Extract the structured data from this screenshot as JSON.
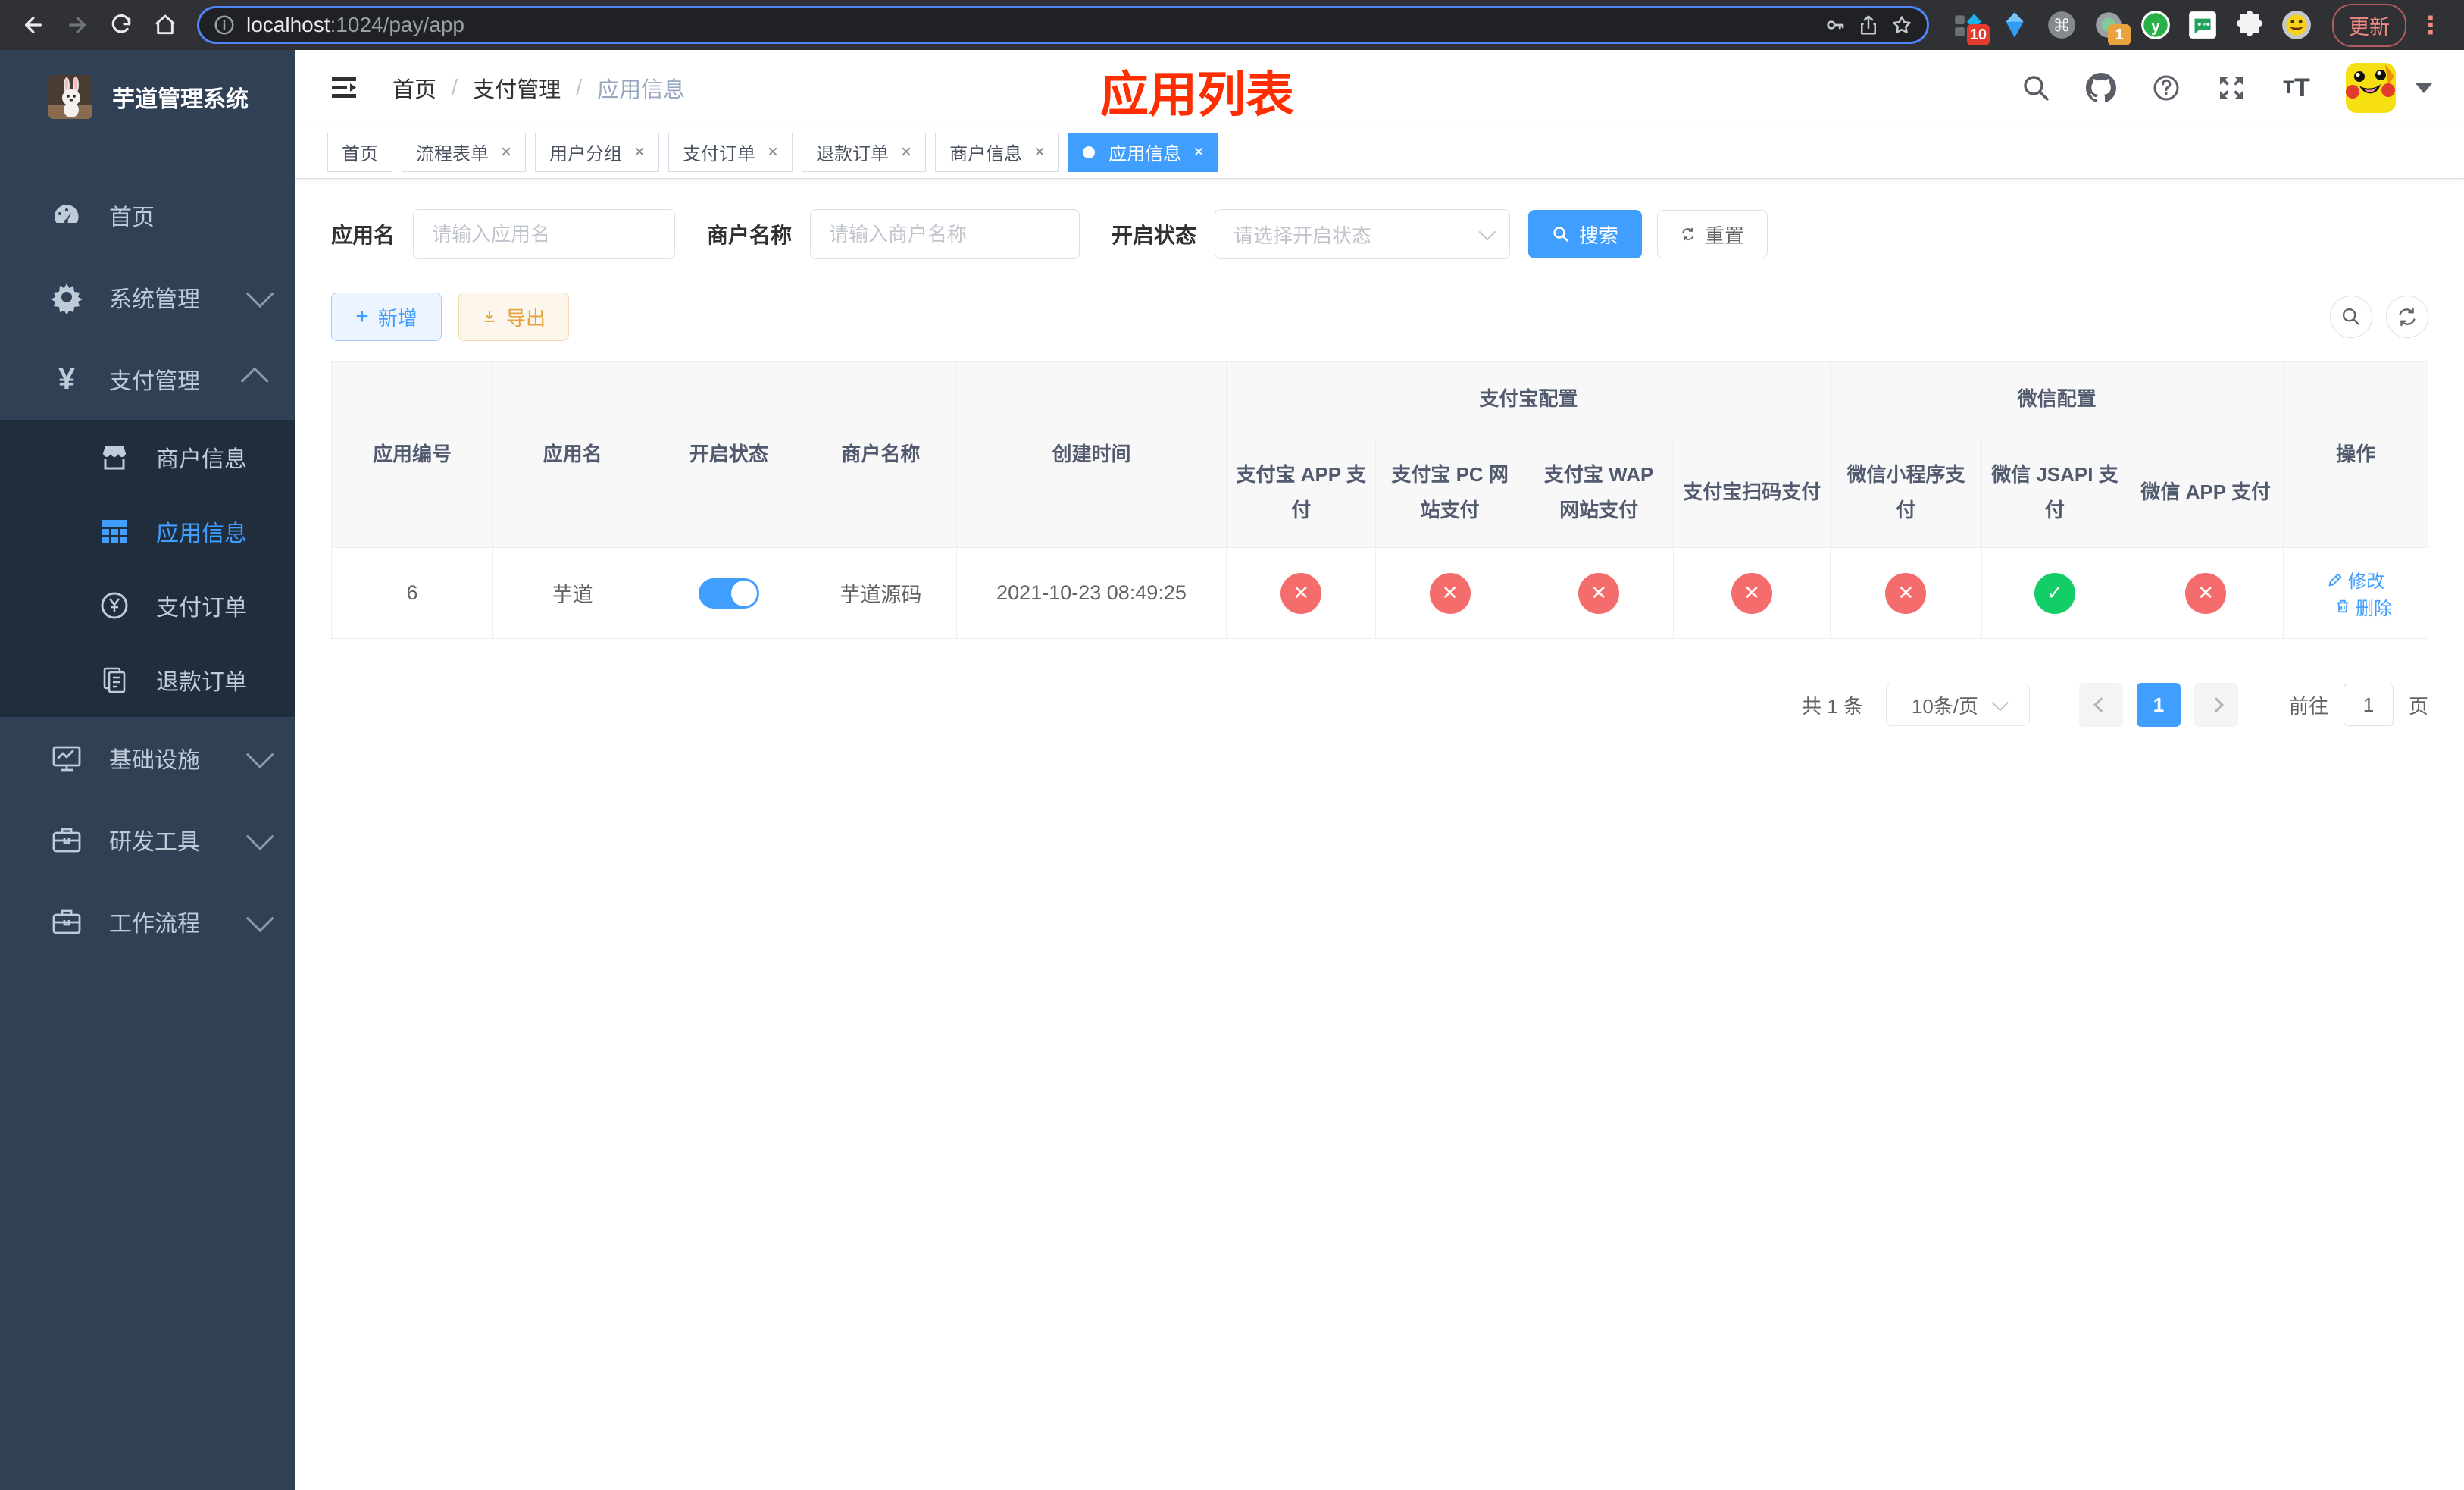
{
  "browser": {
    "url_host": "localhost",
    "url_rest": ":1024/pay/app",
    "ext_badge_pin": "10",
    "ext_badge_circle": "1",
    "update_label": "更新"
  },
  "sidebar": {
    "title": "芋道管理系统",
    "home": "首页",
    "system": "系统管理",
    "payment": "支付管理",
    "merchant_info": "商户信息",
    "app_info": "应用信息",
    "pay_order": "支付订单",
    "refund_order": "退款订单",
    "infra": "基础设施",
    "dev_tools": "研发工具",
    "workflow": "工作流程"
  },
  "header": {
    "crumb_home": "首页",
    "crumb_payment": "支付管理",
    "crumb_current": "应用信息",
    "annotation": "应用列表"
  },
  "tabs": [
    {
      "label": "首页"
    },
    {
      "label": "流程表单"
    },
    {
      "label": "用户分组"
    },
    {
      "label": "支付订单"
    },
    {
      "label": "退款订单"
    },
    {
      "label": "商户信息"
    },
    {
      "label": "应用信息"
    }
  ],
  "filters": {
    "app_name_label": "应用名",
    "app_name_placeholder": "请输入应用名",
    "merchant_label": "商户名称",
    "merchant_placeholder": "请输入商户名称",
    "status_label": "开启状态",
    "status_placeholder": "请选择开启状态",
    "search_label": "搜索",
    "reset_label": "重置"
  },
  "toolbar": {
    "add_label": "新增",
    "export_label": "导出"
  },
  "table": {
    "col_id": "应用编号",
    "col_name": "应用名",
    "col_status": "开启状态",
    "col_merchant": "商户名称",
    "col_created": "创建时间",
    "group_alipay": "支付宝配置",
    "group_wechat": "微信配置",
    "col_alipay_app": "支付宝 APP 支付",
    "col_alipay_pc": "支付宝 PC 网站支付",
    "col_alipay_wap": "支付宝 WAP 网站支付",
    "col_alipay_qr": "支付宝扫码支付",
    "col_wx_mini": "微信小程序支付",
    "col_wx_jsapi": "微信 JSAPI 支付",
    "col_wx_app": "微信 APP 支付",
    "col_actions": "操作",
    "row": {
      "id": "6",
      "name": "芋道",
      "enabled": true,
      "merchant": "芋道源码",
      "created": "2021-10-23 08:49:25",
      "statuses": [
        "no",
        "no",
        "no",
        "no",
        "no",
        "yes",
        "no"
      ],
      "edit_label": "修改",
      "delete_label": "删除"
    }
  },
  "pagination": {
    "total_text": "共 1 条",
    "page_size": "10条/页",
    "current_page": "1",
    "goto_label": "前往",
    "goto_value": "1",
    "page_unit": "页"
  },
  "colors": {
    "primary": "#409eff",
    "danger": "#f56c6c",
    "success": "#13ce66",
    "sidebar_bg": "#304156",
    "submenu_bg": "#1f2d3d",
    "annotation_red": "#ff2d00"
  }
}
